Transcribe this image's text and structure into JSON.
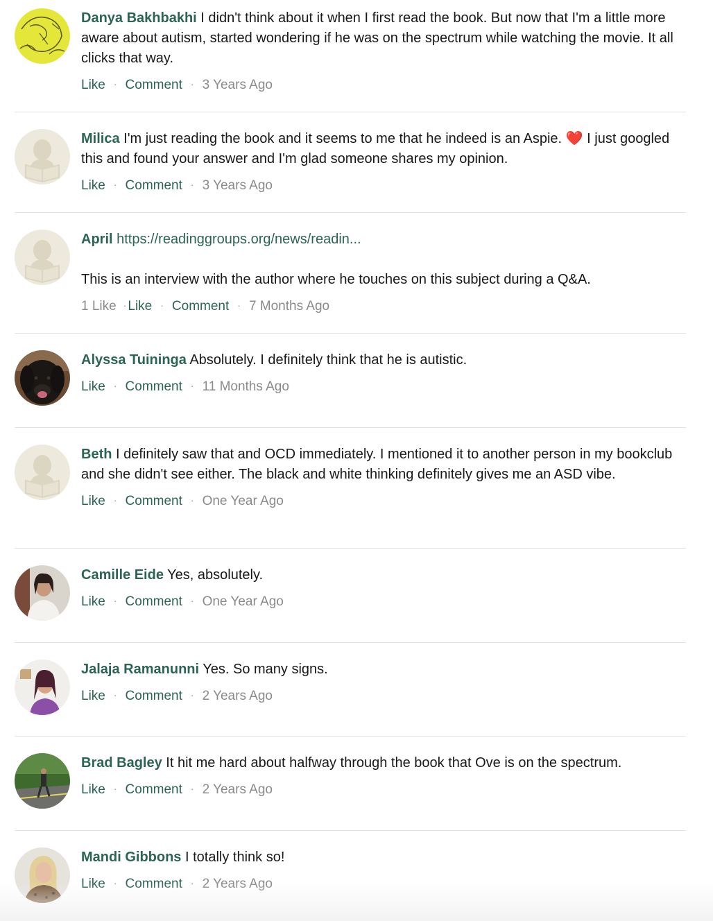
{
  "comments": [
    {
      "author": "Danya Bakhbakhi",
      "text": "I didn't think about it when I first read the book. But now that I'm a little more aware about autism, started wondering if he was on the spectrum while watching the movie. It all clicks that way.",
      "like": "Like",
      "comment": "Comment",
      "time": "3 Years Ago"
    },
    {
      "author": "Milica",
      "text_before": "I'm just reading the book and it seems to me that he indeed is an Aspie.",
      "emoji": "❤️",
      "text_after": "I just googled this and found your answer and I'm glad someone shares my opinion.",
      "like": "Like",
      "comment": "Comment",
      "time": "3 Years Ago"
    },
    {
      "author": "April",
      "link": "https://readinggroups.org/news/readin...",
      "text": "This is an interview with the author where he touches on this subject during a Q&A.",
      "likes_count": "1 Like",
      "like": "Like",
      "comment": "Comment",
      "time": "7 Months Ago"
    },
    {
      "author": "Alyssa Tuininga",
      "text": "Absolutely. I definitely think that he is autistic.",
      "like": "Like",
      "comment": "Comment",
      "time": "11 Months Ago"
    },
    {
      "author": "Beth",
      "text": "I definitely saw that and OCD immediately. I mentioned it to another person in my bookclub and she didn't see either. The black and white thinking definitely gives me an ASD vibe.",
      "like": "Like",
      "comment": "Comment",
      "time": "One Year Ago"
    },
    {
      "author": "Camille Eide",
      "text": "Yes, absolutely.",
      "like": "Like",
      "comment": "Comment",
      "time": "One Year Ago"
    },
    {
      "author": "Jalaja Ramanunni",
      "text": "Yes. So many signs.",
      "like": "Like",
      "comment": "Comment",
      "time": "2 Years Ago"
    },
    {
      "author": "Brad Bagley",
      "text": "It hit me hard about halfway through the book that Ove is on the spectrum.",
      "like": "Like",
      "comment": "Comment",
      "time": "2 Years Ago"
    },
    {
      "author": "Mandi Gibbons",
      "text": "I totally think so!",
      "like": "Like",
      "comment": "Comment",
      "time": "2 Years Ago"
    }
  ],
  "colors": {
    "accent": "#2b6455",
    "muted": "#8a8a8a",
    "divider": "#e1e1e1",
    "placeholder_avatar": "#ede9dc"
  }
}
